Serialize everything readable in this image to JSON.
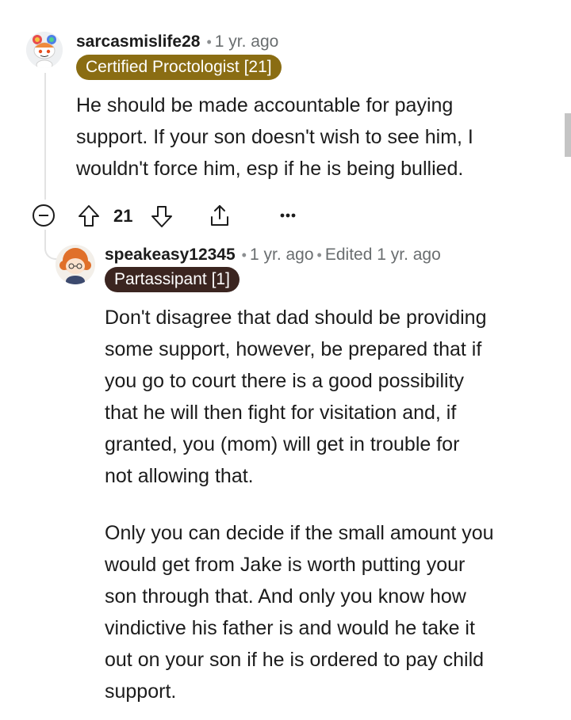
{
  "comment1": {
    "username": "sarcasmislife28",
    "separator": "•",
    "age": "1 yr. ago",
    "flair": "Certified Proctologist [21]",
    "flair_color": "#8a6d13",
    "body_lines": [
      "He should be made accountable for paying",
      "support. If your son doesn't wish to see him, I",
      "wouldn't force him, esp if he is being bullied."
    ],
    "actions": {
      "collapse_icon": "collapse-minus-icon",
      "upvote_icon": "upvote-arrow-icon",
      "score": "21",
      "downvote_icon": "downvote-arrow-icon",
      "share_icon": "share-icon",
      "more_icon": "more-options-icon"
    }
  },
  "comment2": {
    "username": "speakeasy12345",
    "separator": "•",
    "age": "1 yr. ago",
    "separator2": "•",
    "edited": "Edited 1 yr. ago",
    "flair": "Partassipant [1]",
    "flair_color": "#3b2520",
    "paragraphs": [
      [
        "Don't disagree that dad should be providing",
        "some support, however, be prepared that if",
        "you go to court there is a good possibility",
        "that he will then fight for visitation and, if",
        "granted, you (mom) will get in trouble for",
        "not allowing that."
      ],
      [
        "Only you can decide if the small amount you",
        "would get from Jake is worth putting your",
        "son through that. And only you know how",
        "vindictive his father is and would he take it",
        "out on your son if he is ordered to pay child",
        "support."
      ]
    ]
  }
}
